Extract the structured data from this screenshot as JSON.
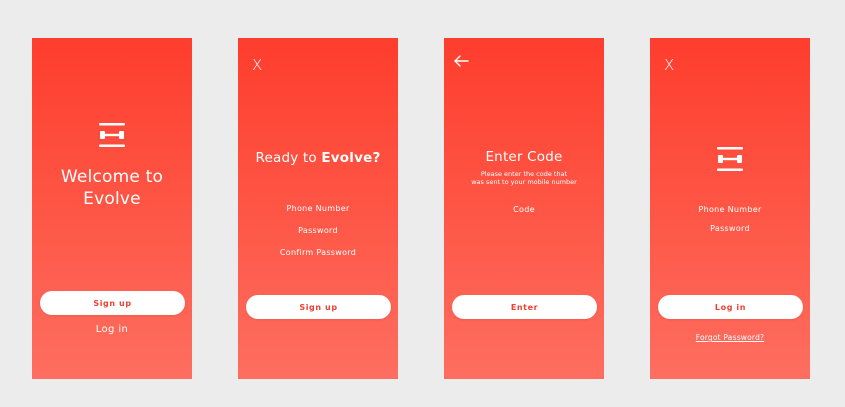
{
  "screens": {
    "welcome": {
      "title_line1": "Welcome to",
      "title_line2": "Evolve",
      "signup_label": "Sign up",
      "login_label": "Log in"
    },
    "signup": {
      "close_glyph": "X",
      "title_prefix": "Ready to ",
      "title_brand": "Evolve?",
      "fields": [
        "Phone Number",
        "Password",
        "Confirm Password"
      ],
      "signup_label": "Sign up"
    },
    "code": {
      "back_icon": "arrow-left-icon",
      "title": "Enter Code",
      "subtitle_line1": "Please enter the code that",
      "subtitle_line2": "was sent to your mobile number",
      "field": "Code",
      "enter_label": "Enter"
    },
    "login": {
      "close_glyph": "X",
      "fields": [
        "Phone Number",
        "Password"
      ],
      "login_label": "Log in",
      "forgot_label": "Forgot Password?"
    }
  },
  "colors": {
    "gradient_top": "#fe3d2d",
    "gradient_bottom": "#fe6e60",
    "button_text": "#f0412f",
    "background": "#ececec"
  },
  "icons": {
    "logo": "evolve-logo-icon",
    "close": "close-icon",
    "back": "arrow-left-icon"
  }
}
